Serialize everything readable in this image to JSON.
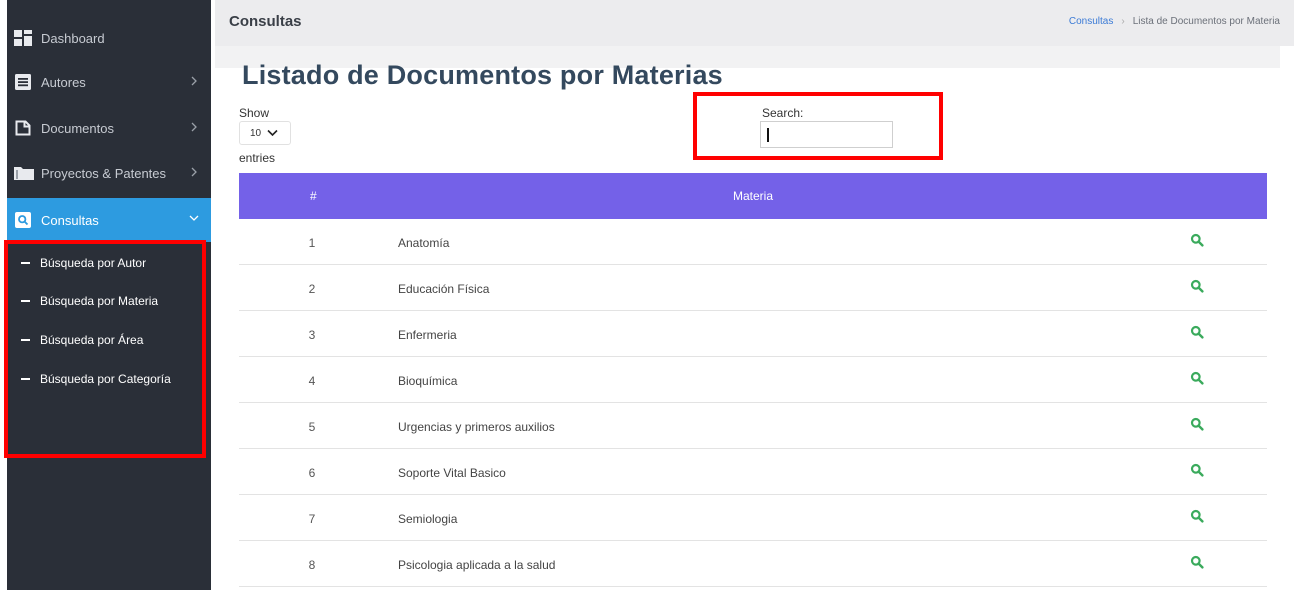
{
  "sidebar": {
    "items": [
      {
        "label": "Dashboard",
        "icon": "dashboard-icon"
      },
      {
        "label": "Autores",
        "icon": "list-icon"
      },
      {
        "label": "Documentos",
        "icon": "document-icon"
      },
      {
        "label": "Proyectos & Patentes",
        "icon": "folder-icon"
      },
      {
        "label": "Consultas",
        "icon": "search-square-icon"
      }
    ],
    "submenu": [
      {
        "label": "Búsqueda por Autor"
      },
      {
        "label": "Búsqueda por Materia"
      },
      {
        "label": "Búsqueda por Área"
      },
      {
        "label": "Búsqueda por Categoría"
      }
    ]
  },
  "header": {
    "title": "Consultas",
    "breadcrumb": {
      "link": "Consultas",
      "current": "Lista de Documentos por Materia"
    }
  },
  "main": {
    "heading": "Listado de Documentos por Materias",
    "length": {
      "show_label": "Show",
      "value": "10",
      "entries_label": "entries"
    },
    "search": {
      "label": "Search:",
      "value": "",
      "placeholder": ""
    },
    "table": {
      "columns": [
        "#",
        "Materia"
      ],
      "rows": [
        {
          "num": "1",
          "materia": "Anatomía"
        },
        {
          "num": "2",
          "materia": "Educación Física"
        },
        {
          "num": "3",
          "materia": "Enfermeria"
        },
        {
          "num": "4",
          "materia": "Bioquímica"
        },
        {
          "num": "5",
          "materia": "Urgencias y primeros auxilios"
        },
        {
          "num": "6",
          "materia": "Soporte Vital Basico"
        },
        {
          "num": "7",
          "materia": "Semiologia"
        },
        {
          "num": "8",
          "materia": "Psicologia aplicada a la salud"
        }
      ]
    }
  },
  "colors": {
    "sidebar_bg": "#2a2f38",
    "active_bg": "#2d9be0",
    "table_header_bg": "#7461e8",
    "action_icon": "#3aaa5c",
    "annotation_box": "#ff0000"
  }
}
